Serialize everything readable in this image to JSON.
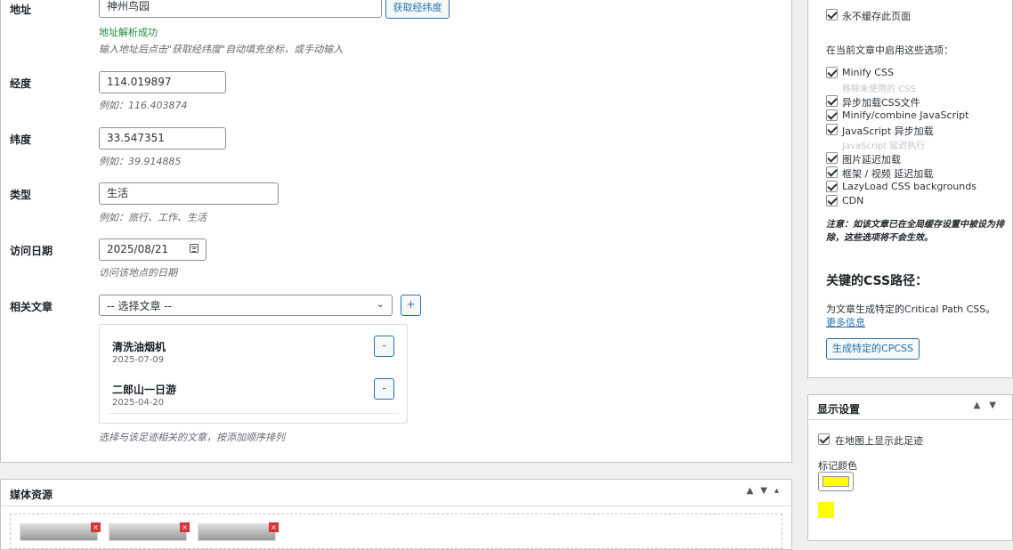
{
  "form": {
    "address_label": "地址",
    "address_value": "神州鸟园",
    "geocode_button": "获取经纬度",
    "geocode_status": "地址解析成功",
    "address_hint": "输入地址后点击\"获取经纬度\"自动填充坐标，或手动输入",
    "longitude_label": "经度",
    "longitude_value": "114.019897",
    "longitude_hint": "例如：116.403874",
    "latitude_label": "纬度",
    "latitude_value": "33.547351",
    "latitude_hint": "例如：39.914885",
    "type_label": "类型",
    "type_value": "生活",
    "type_hint": "例如：旅行、工作、生活",
    "visit_date_label": "访问日期",
    "visit_date_value": "2025/08/21",
    "visit_date_hint": "访问该地点的日期",
    "related_label": "相关文章",
    "related_select": "-- 选择文章 --",
    "add_button": "+",
    "related_items": [
      {
        "title": "清洗油烟机",
        "date": "2025-07-09",
        "remove": "-"
      },
      {
        "title": "二郎山一日游",
        "date": "2025-04-20",
        "remove": "-"
      }
    ],
    "related_hint": "选择与该足迹相关的文章，按添加顺序排列"
  },
  "media": {
    "title": "媒体资源",
    "remove_mark": "×"
  },
  "cache_box": {
    "no_cache_label": "永不缓存此页面",
    "enable_heading": "在当前文章中启用这些选项：",
    "options": [
      "Minify CSS",
      "移除未使用的 CSS",
      "异步加载CSS文件",
      "Minify/combine JavaScript",
      "JavaScript 异步加载",
      "JavaScript 延迟执行",
      "图片延迟加载",
      "框架 / 视频 延迟加载",
      "LazyLoad CSS backgrounds",
      "CDN"
    ],
    "note": "注意：如该文章已在全局缓存设置中被设为排除，这些选项将不会生效。",
    "cpcss_title": "关键的CSS路径：",
    "cpcss_desc": "为文章生成特定的Critical Path CSS。",
    "cpcss_link": "更多信息",
    "cpcss_button": "生成特定的CPCSS"
  },
  "display": {
    "title": "显示设置",
    "show_on_map": "在地图上显示此足迹",
    "marker_color_label": "标记颜色",
    "marker_color": "#ffff00"
  },
  "colors": {
    "accent": "#2271b1",
    "success": "#1e8a3c",
    "remove": "#d63638"
  }
}
